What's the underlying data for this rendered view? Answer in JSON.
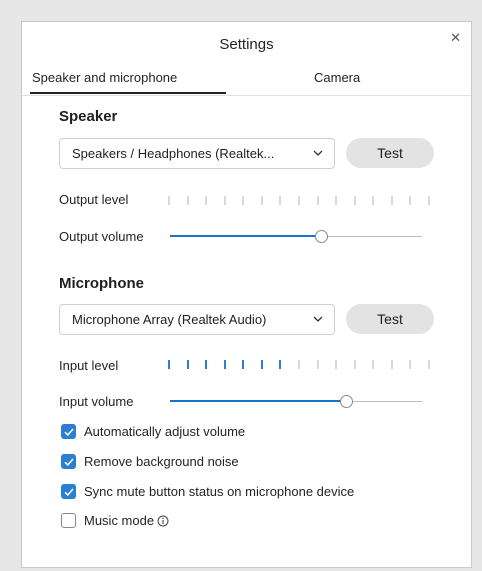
{
  "window": {
    "title": "Settings"
  },
  "tabs": [
    {
      "label": "Speaker and microphone",
      "active": true
    },
    {
      "label": "Camera",
      "active": false
    }
  ],
  "speaker": {
    "title": "Speaker",
    "device": "Speakers / Headphones (Realtek...",
    "test_label": "Test",
    "output_level_label": "Output level",
    "output_level_active_ticks": 0,
    "output_volume_label": "Output volume",
    "output_volume_fraction": 0.6
  },
  "microphone": {
    "title": "Microphone",
    "device": "Microphone Array (Realtek Audio)",
    "test_label": "Test",
    "input_level_label": "Input level",
    "input_level_active_ticks": 7,
    "input_volume_label": "Input volume",
    "input_volume_fraction": 0.7
  },
  "meter": {
    "total_ticks": 15
  },
  "options": [
    {
      "label": "Automatically adjust volume",
      "checked": true
    },
    {
      "label": "Remove background noise",
      "checked": true
    },
    {
      "label": "Sync mute button status on microphone device",
      "checked": true
    },
    {
      "label": "Music mode",
      "checked": false
    }
  ],
  "colors": {
    "accent": "#2b7fd3",
    "button_bg": "#e3e3e3",
    "inactive_tick": "#d8d8d8"
  },
  "icons": {
    "close": "close-icon",
    "dropdown": "chevron-down-icon",
    "check": "checkmark-icon",
    "info": "info-icon"
  }
}
